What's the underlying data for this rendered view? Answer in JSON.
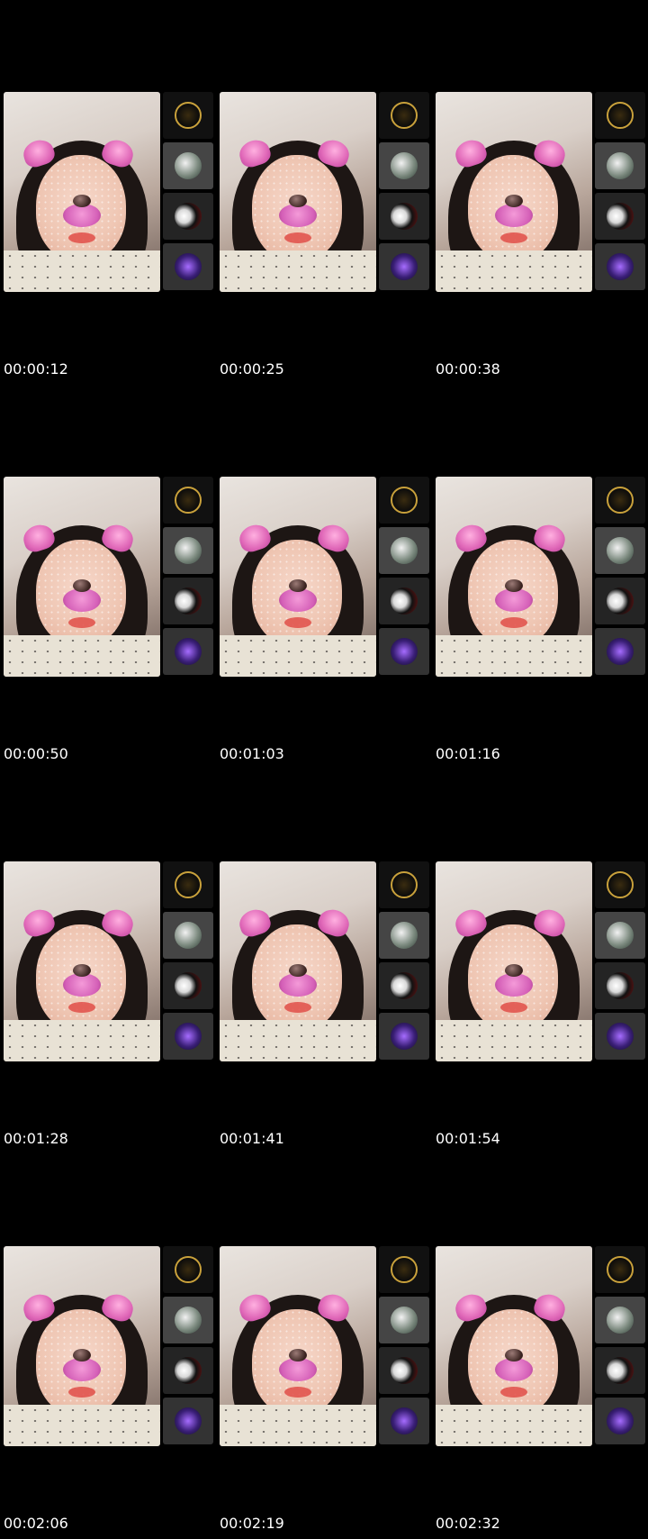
{
  "timestamps": [
    "00:00:12",
    "00:00:25",
    "00:00:38",
    "00:00:50",
    "00:01:03",
    "00:01:16",
    "00:01:28",
    "00:01:41",
    "00:01:54",
    "00:02:06",
    "00:02:19",
    "00:02:32"
  ],
  "side_avatars": [
    "gold-emblem-avatar",
    "bearded-man-avatar",
    "masked-person-avatar",
    "purple-character-avatar"
  ]
}
